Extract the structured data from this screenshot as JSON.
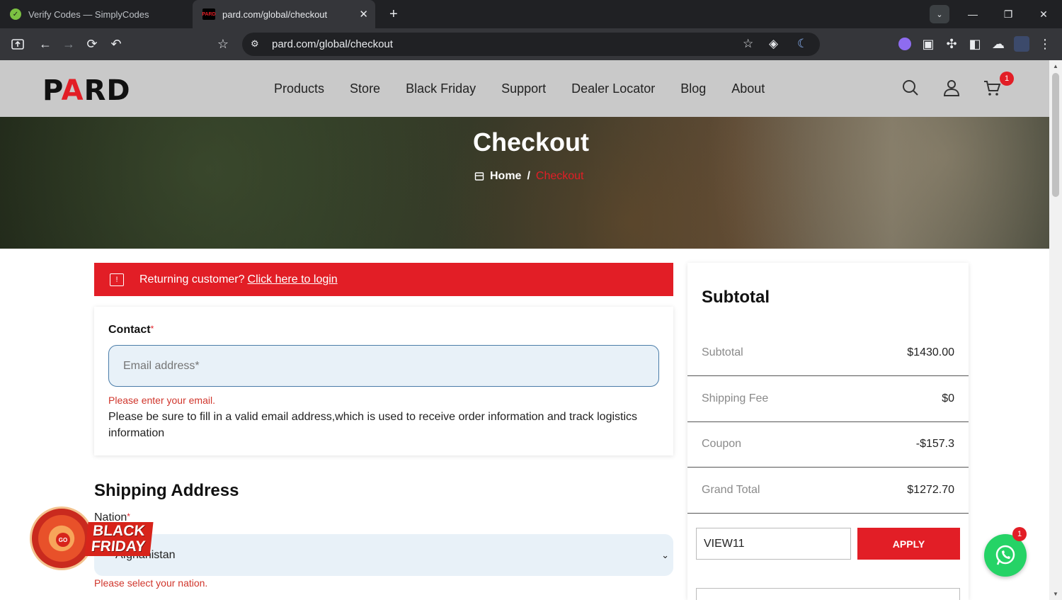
{
  "browser": {
    "tabs": [
      {
        "title": "Verify Codes — SimplyCodes",
        "favicon": "simplycodes-icon"
      },
      {
        "title": "pard.com/global/checkout",
        "favicon": "pard-icon"
      }
    ],
    "url": "pard.com/global/checkout"
  },
  "site": {
    "logo_left": "P",
    "logo_a": "A",
    "logo_right": "RD",
    "nav": [
      "Products",
      "Store",
      "Black Friday",
      "Support",
      "Dealer Locator",
      "Blog",
      "About"
    ],
    "cart_count": "1",
    "accent_color": "#e21e26"
  },
  "hero": {
    "title": "Checkout",
    "breadcrumb_home": "Home",
    "breadcrumb_sep": "/",
    "breadcrumb_current": "Checkout"
  },
  "notice": {
    "text": "Returning customer?",
    "link": "Click here to login"
  },
  "contact": {
    "label": "Contact",
    "required": "*",
    "email_placeholder": "Email address*",
    "error": "Please enter your email.",
    "hint": "Please be sure to fill in a valid email address,which is used to receive order information and track logistics information"
  },
  "shipping": {
    "title": "Shipping Address",
    "nation_label": "Nation",
    "nation_value": "Afghanistan",
    "nation_error": "Please select your nation."
  },
  "promo": {
    "line1": "BLACK",
    "line2": "FRIDAY",
    "wheel": "GO"
  },
  "summary": {
    "title": "Subtotal",
    "rows": [
      {
        "label": "Subtotal",
        "value": "$1430.00"
      },
      {
        "label": "Shipping Fee",
        "value": "$0"
      },
      {
        "label": "Coupon",
        "value": "-$157.3"
      },
      {
        "label": "Grand Total",
        "value": "$1272.70"
      }
    ],
    "coupon_code": "VIEW11",
    "apply_label": "APPLY"
  },
  "whatsapp": {
    "count": "1"
  }
}
